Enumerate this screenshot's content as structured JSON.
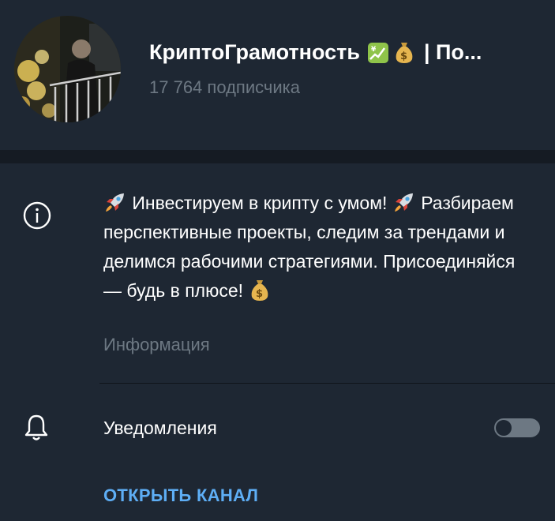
{
  "colors": {
    "background": "#1e2733",
    "band": "#151b23",
    "primary_text": "#ffffff",
    "secondary_text": "#6d7883",
    "accent": "#5eaef5"
  },
  "header": {
    "channel_name": "КриптоГрамотность",
    "title_emojis": [
      "chart-yen-emoji",
      "money-bag-emoji"
    ],
    "title_suffix": "| По...",
    "subscribers": "17 764 подписчика",
    "avatar_icon": "channel-avatar"
  },
  "info": {
    "icon": "info-icon",
    "description_line1": "Инвестируем в крипту с умом!",
    "description_body": "Разбираем перспективные проекты, следим за трендами и делимся рабочими стратегиями. Присоединяйся — будь в плюсе!",
    "emojis": [
      "rocket-emoji",
      "rocket-emoji",
      "money-bag-emoji"
    ],
    "caption": "Информация"
  },
  "notifications": {
    "icon": "bell-icon",
    "label": "Уведомления",
    "enabled": false
  },
  "actions": {
    "open_channel": "ОТКРЫТЬ КАНАЛ"
  }
}
